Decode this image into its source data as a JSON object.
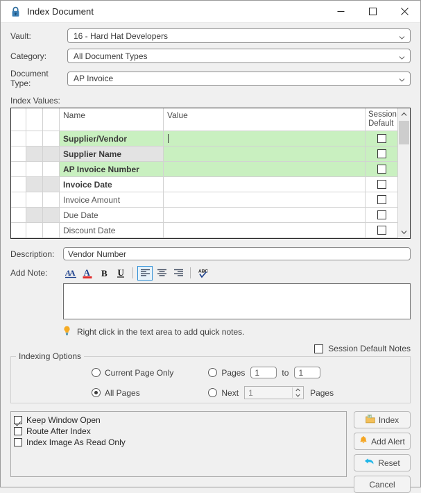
{
  "window": {
    "title": "Index Document",
    "lock_icon": "lock-icon",
    "minimize_label": "–",
    "maximize_label": "□",
    "close_label": "×"
  },
  "fields": {
    "vault": {
      "label": "Vault:",
      "value": "16 - Hard Hat Developers"
    },
    "category": {
      "label": "Category:",
      "value": "All Document Types"
    },
    "document_type": {
      "label": "Document Type:",
      "value": "AP Invoice"
    }
  },
  "index_values": {
    "label": "Index Values:",
    "columns": [
      "",
      "",
      "",
      "Name",
      "Value",
      "Session\nDefault"
    ],
    "header_name": "Name",
    "header_value": "Value",
    "header_session_default_line1": "Session",
    "header_session_default_line2": "Default",
    "rows": [
      {
        "name": "Supplier/Vendor",
        "value": "",
        "bold": true,
        "highlight": "green",
        "shade": false,
        "session_default": false,
        "cursor": true
      },
      {
        "name": "Supplier Name",
        "value": "",
        "bold": true,
        "highlight": "green",
        "shade": true,
        "session_default": false,
        "cursor": false
      },
      {
        "name": "AP Invoice Number",
        "value": "",
        "bold": true,
        "highlight": "green",
        "shade": false,
        "session_default": false,
        "cursor": false
      },
      {
        "name": "Invoice Date",
        "value": "",
        "bold": true,
        "highlight": "none",
        "shade": true,
        "session_default": false,
        "cursor": false
      },
      {
        "name": "Invoice Amount",
        "value": "",
        "bold": false,
        "highlight": "none",
        "shade": false,
        "session_default": false,
        "cursor": false
      },
      {
        "name": "Due Date",
        "value": "",
        "bold": false,
        "highlight": "none",
        "shade": true,
        "session_default": false,
        "cursor": false
      },
      {
        "name": "Discount Date",
        "value": "",
        "bold": false,
        "highlight": "none",
        "shade": false,
        "session_default": false,
        "cursor": false
      }
    ]
  },
  "description": {
    "label": "Description:",
    "value": "Vendor Number"
  },
  "add_note": {
    "label": "Add Note:",
    "value": "",
    "toolbar": [
      {
        "name": "font-style-icon",
        "title": "Font"
      },
      {
        "name": "font-color-icon",
        "title": "Font Color"
      },
      {
        "name": "bold-icon",
        "title": "Bold",
        "glyph": "B"
      },
      {
        "name": "underline-icon",
        "title": "Underline",
        "glyph": "U"
      },
      {
        "name": "align-left-icon",
        "title": "Align Left",
        "active": true
      },
      {
        "name": "align-center-icon",
        "title": "Align Center"
      },
      {
        "name": "align-right-icon",
        "title": "Align Right"
      },
      {
        "name": "spell-check-icon",
        "title": "Spell Check"
      }
    ]
  },
  "hint": {
    "icon": "lightbulb-icon",
    "text": "Right click in the text area to add quick notes."
  },
  "session_default_notes": {
    "label": "Session Default Notes",
    "checked": false
  },
  "indexing_options": {
    "legend": "Indexing Options",
    "current_page_only": {
      "label": "Current Page Only",
      "selected": false
    },
    "all_pages": {
      "label": "All Pages",
      "selected": true
    },
    "pages": {
      "label": "Pages",
      "selected": false,
      "from": "1",
      "to_label": "to",
      "to": "1"
    },
    "next": {
      "label": "Next",
      "selected": false,
      "count": "1",
      "suffix": "Pages"
    }
  },
  "options_panel": [
    {
      "label": "Keep Window Open",
      "checked": true
    },
    {
      "label": "Route After Index",
      "checked": false
    },
    {
      "label": "Index Image As Read Only",
      "checked": false
    }
  ],
  "buttons": [
    {
      "label": "Index",
      "icon": "index-icon"
    },
    {
      "label": "Add Alert",
      "icon": "bell-icon"
    },
    {
      "label": "Reset",
      "icon": "undo-arrow-icon"
    },
    {
      "label": "Cancel",
      "icon": ""
    }
  ],
  "colors": {
    "highlight_green": "#c9f0c0",
    "row_shade": "#e3e3e3",
    "accent_blue": "#2f8fd6",
    "alert_orange": "#f5a623",
    "reset_cyan": "#1fb6e8",
    "window_bg": "#f0f0f0"
  }
}
